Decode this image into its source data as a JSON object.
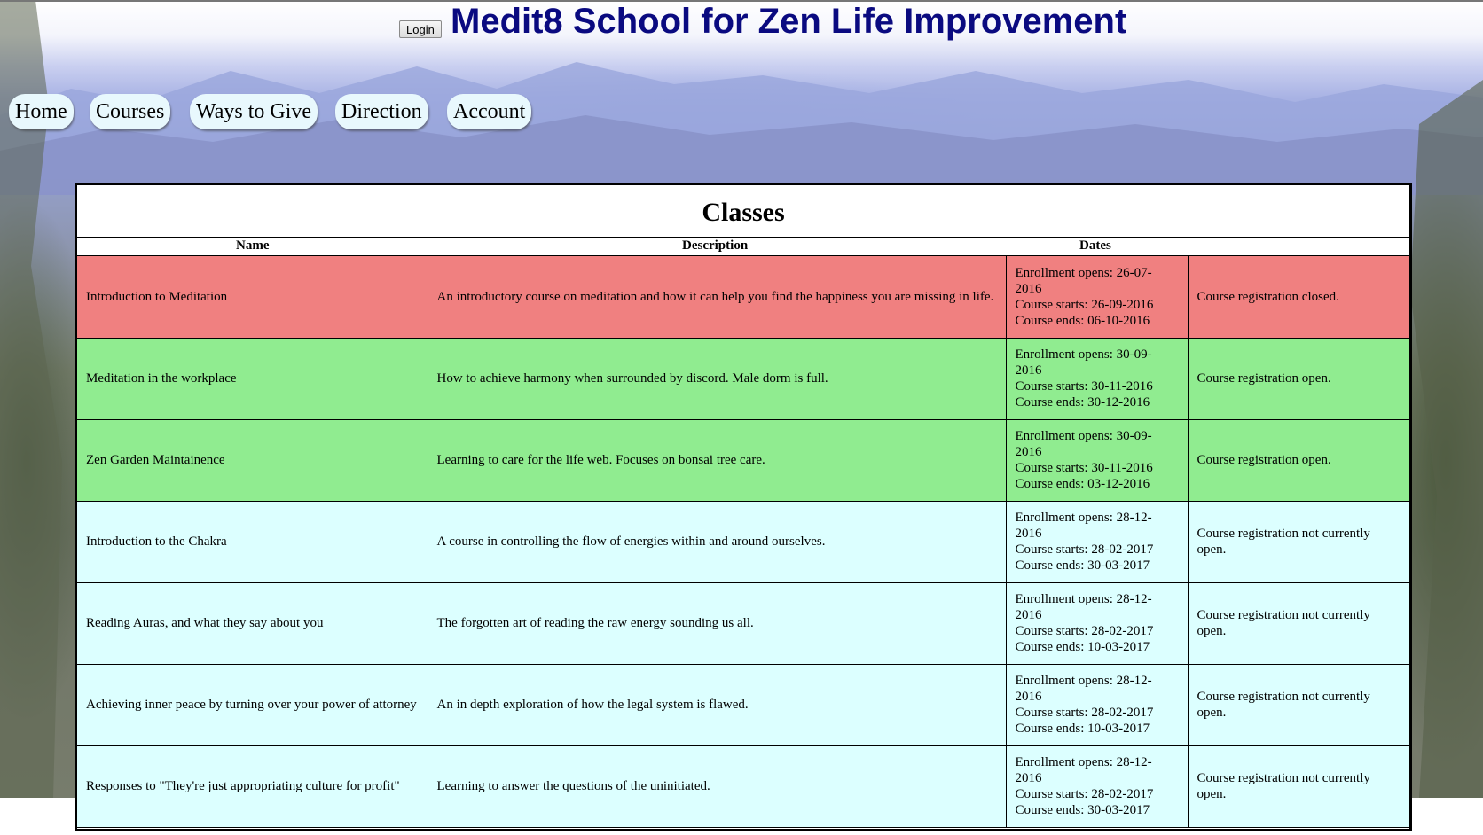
{
  "header": {
    "login_label": "Login",
    "title": "Medit8 School for Zen Life Improvement"
  },
  "nav": {
    "items": [
      {
        "label": "Home"
      },
      {
        "label": "Courses"
      },
      {
        "label": "Ways to Give"
      },
      {
        "label": "Direction"
      },
      {
        "label": "Account"
      }
    ]
  },
  "classes": {
    "title": "Classes",
    "columns": [
      "Name",
      "Description",
      "Dates"
    ],
    "rows": [
      {
        "status": "closed",
        "name": "Introduction to Meditation",
        "description": "An introductory course on meditation and how it can help you find the happiness you are missing in life.",
        "enrollment": "Enrollment opens: 26-07-2016",
        "starts": "Course starts: 26-09-2016",
        "ends": "Course ends: 06-10-2016",
        "registration": "Course registration closed."
      },
      {
        "status": "open",
        "name": "Meditation in the workplace",
        "description": "How to achieve harmony when surrounded by discord. Male dorm is full.",
        "enrollment": "Enrollment opens: 30-09-2016",
        "starts": "Course starts: 30-11-2016",
        "ends": "Course ends: 30-12-2016",
        "registration": "Course registration open."
      },
      {
        "status": "open",
        "name": "Zen Garden Maintainence",
        "description": "Learning to care for the life web. Focuses on bonsai tree care.",
        "enrollment": "Enrollment opens: 30-09-2016",
        "starts": "Course starts: 30-11-2016",
        "ends": "Course ends: 03-12-2016",
        "registration": "Course registration open."
      },
      {
        "status": "notopen",
        "name": "Introduction to the Chakra",
        "description": "A course in controlling the flow of energies within and around ourselves.",
        "enrollment": "Enrollment opens: 28-12-2016",
        "starts": "Course starts: 28-02-2017",
        "ends": "Course ends: 30-03-2017",
        "registration": "Course registration not currently open."
      },
      {
        "status": "notopen",
        "name": "Reading Auras, and what they say about you",
        "description": "The forgotten art of reading the raw energy sounding us all.",
        "enrollment": "Enrollment opens: 28-12-2016",
        "starts": "Course starts: 28-02-2017",
        "ends": "Course ends: 10-03-2017",
        "registration": "Course registration not currently open."
      },
      {
        "status": "notopen",
        "name": "Achieving inner peace by turning over your power of attorney",
        "description": "An in depth exploration of how the legal system is flawed.",
        "enrollment": "Enrollment opens: 28-12-2016",
        "starts": "Course starts: 28-02-2017",
        "ends": "Course ends: 10-03-2017",
        "registration": "Course registration not currently open."
      },
      {
        "status": "notopen",
        "name": "Responses to \"They're just appropriating culture for profit\"",
        "description": "Learning to answer the questions of the uninitiated.",
        "enrollment": "Enrollment opens: 28-12-2016",
        "starts": "Course starts: 28-02-2017",
        "ends": "Course ends: 30-03-2017",
        "registration": "Course registration not currently open."
      }
    ]
  },
  "colors": {
    "title": "#0a0a80",
    "closed_row": "#f08080",
    "open_row": "#90ec90",
    "notopen_row": "#dcffff",
    "nav_button": "#e8f8fd"
  }
}
